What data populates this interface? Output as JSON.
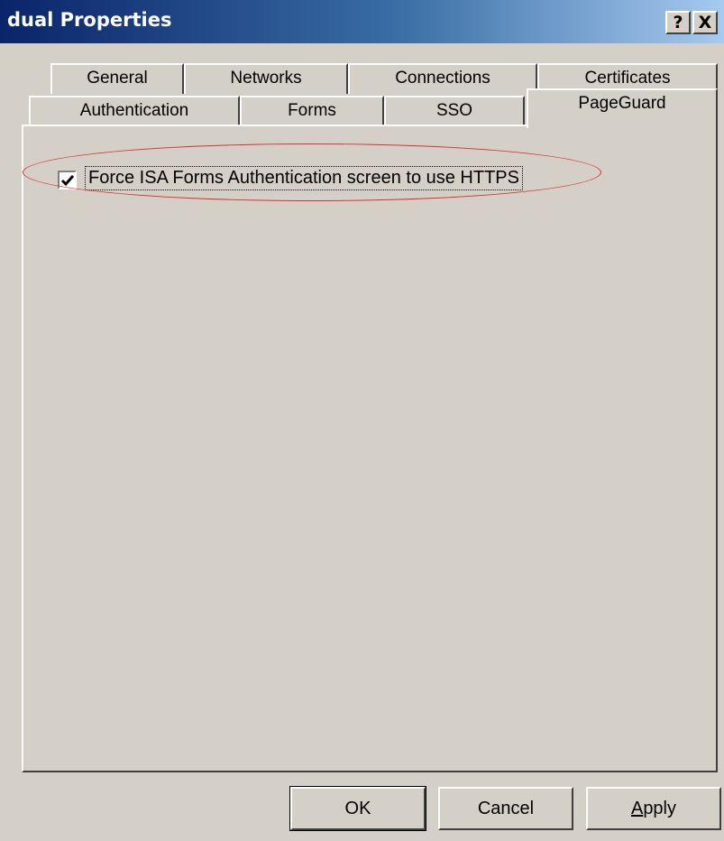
{
  "window": {
    "title": "dual Properties",
    "help_glyph": "?",
    "close_glyph": "X"
  },
  "tabs": {
    "row1": [
      {
        "label": "General"
      },
      {
        "label": "Networks"
      },
      {
        "label": "Connections"
      },
      {
        "label": "Certificates"
      }
    ],
    "row2": [
      {
        "label": "Authentication"
      },
      {
        "label": "Forms"
      },
      {
        "label": "SSO"
      },
      {
        "label": "PageGuard",
        "selected": true
      }
    ]
  },
  "pageguard": {
    "force_https_label": "Force ISA Forms Authentication screen to use HTTPS",
    "force_https_checked": true
  },
  "buttons": {
    "ok": "OK",
    "cancel": "Cancel",
    "apply_accel": "A",
    "apply_rest": "pply"
  },
  "colors": {
    "title_start": "#0a246a",
    "title_end": "#a6caf0",
    "face": "#d4d0c8",
    "highlight_ellipse": "#d83030"
  }
}
